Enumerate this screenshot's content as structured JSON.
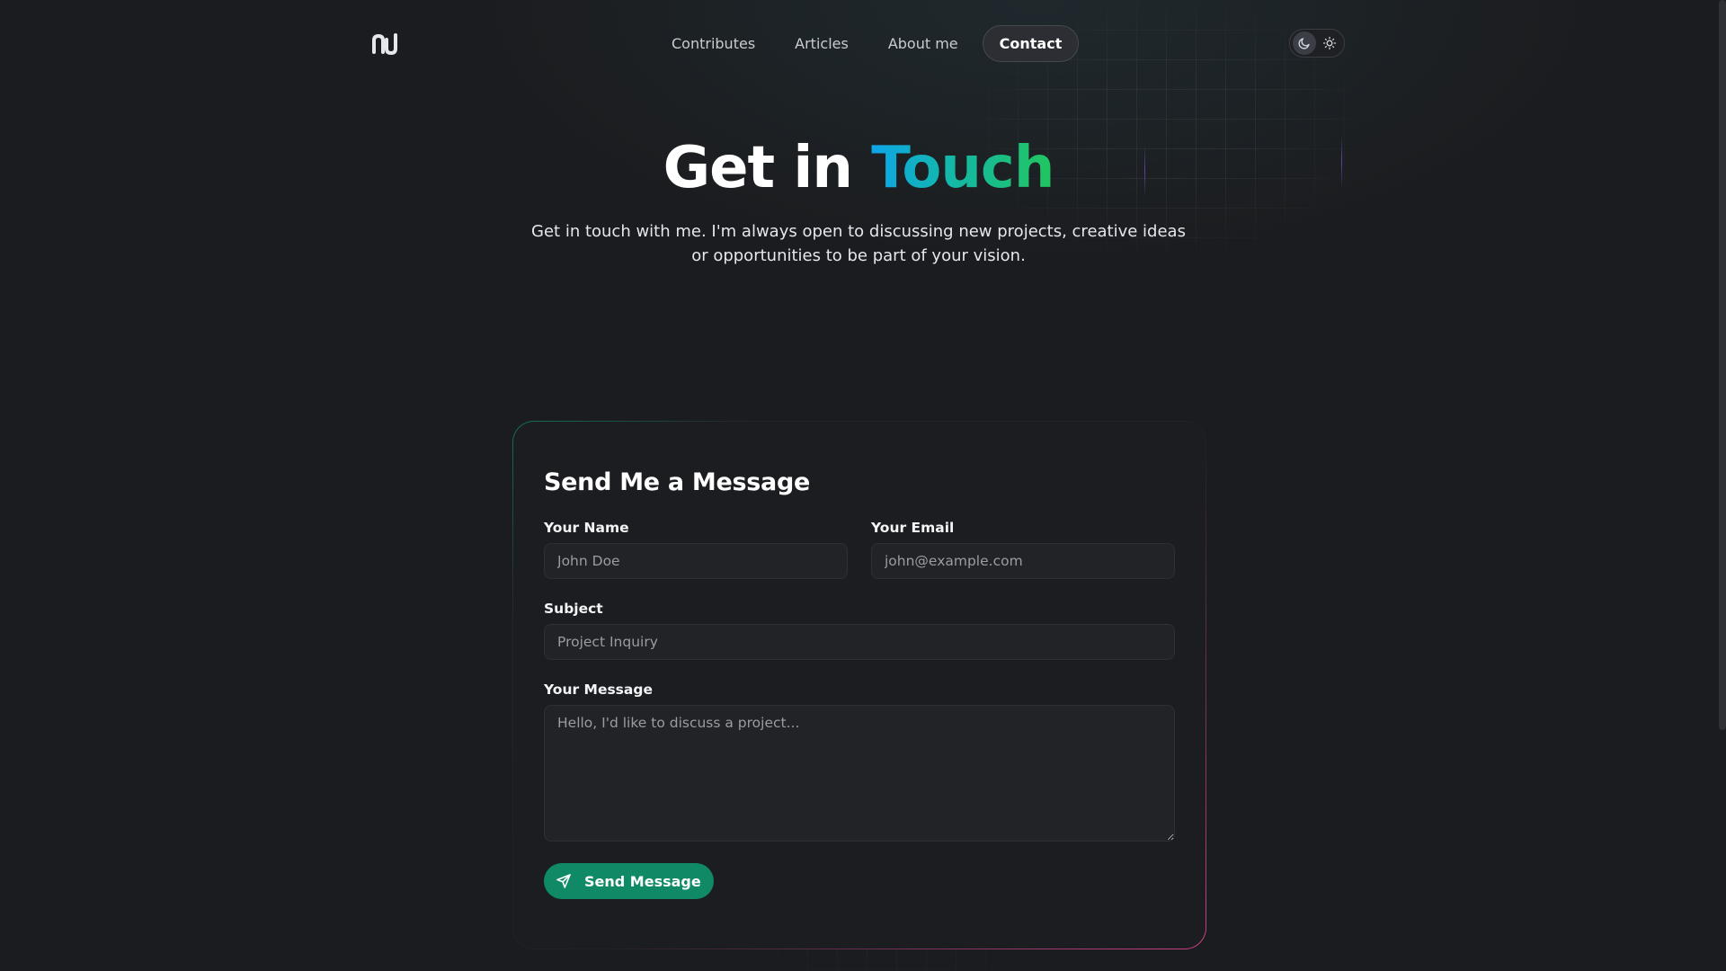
{
  "brand": {
    "logo_text": "ꞃJ"
  },
  "nav": {
    "items": [
      {
        "label": "Contributes"
      },
      {
        "label": "Articles"
      },
      {
        "label": "About me"
      },
      {
        "label": "Contact",
        "active": true
      }
    ]
  },
  "theme_toggle": {
    "dark_icon": "moon-icon",
    "light_icon": "sun-icon",
    "selected": "dark"
  },
  "hero": {
    "title_plain": "Get in ",
    "title_accent": "Touch",
    "subtitle": "Get in touch with me. I'm always open to discussing new projects, creative ideas or opportunities to be part of your vision."
  },
  "form": {
    "title": "Send Me a Message",
    "name_label": "Your Name",
    "name_placeholder": "John Doe",
    "email_label": "Your Email",
    "email_placeholder": "john@example.com",
    "subject_label": "Subject",
    "subject_placeholder": "Project Inquiry",
    "message_label": "Your Message",
    "message_placeholder": "Hello, I'd like to discuss a project...",
    "submit_label": "Send Message",
    "submit_icon": "send-icon"
  },
  "colors": {
    "background": "#1b1c1f",
    "accent_green": "#108a66",
    "gradient_start": "#0ea5e9",
    "gradient_end": "#22c55e",
    "border_pink": "#ec4899"
  }
}
